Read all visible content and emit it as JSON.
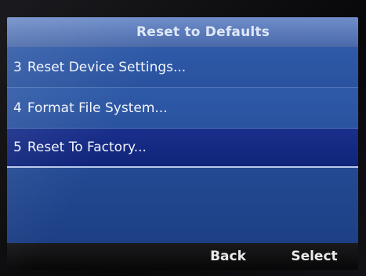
{
  "header": {
    "title": "Reset to Defaults"
  },
  "menu": {
    "items": [
      {
        "number": "3",
        "label": "Reset Device Settings...",
        "selected": false
      },
      {
        "number": "4",
        "label": "Format File System...",
        "selected": false
      },
      {
        "number": "5",
        "label": "Reset To Factory...",
        "selected": true
      }
    ]
  },
  "softkeys": {
    "key1": "",
    "key2": "",
    "key3": "Back",
    "key4": "Select"
  },
  "colors": {
    "background": "#27509c",
    "selected_row": "#142a82",
    "title_bar": "#5a79b8",
    "softkey_bar": "#0d0d0f"
  }
}
